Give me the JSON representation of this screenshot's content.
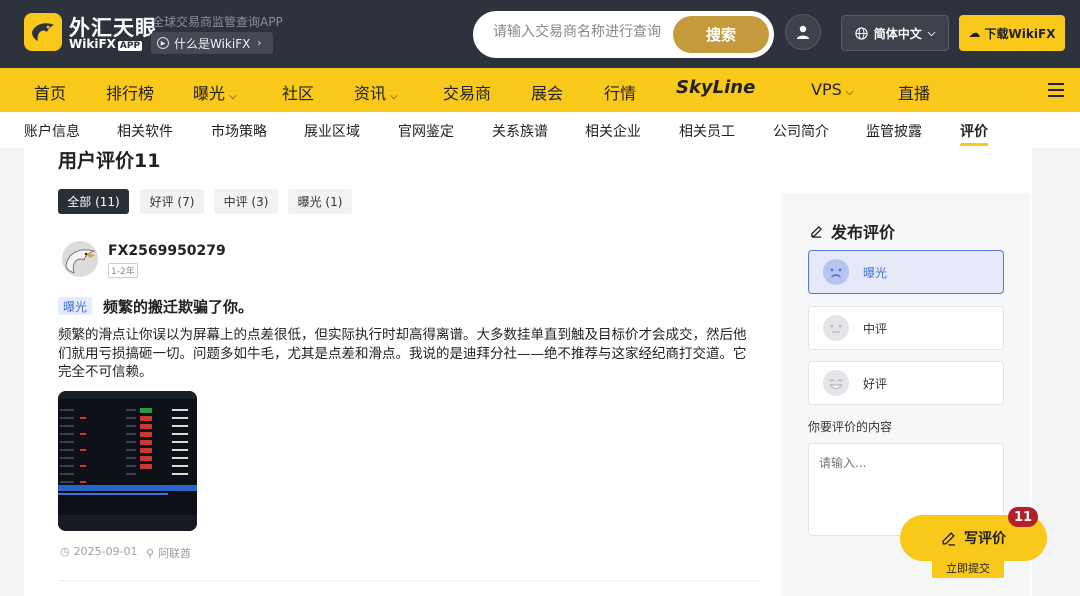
{
  "header": {
    "logo_cn": "外汇天眼",
    "logo_en": "WikiFX",
    "logo_app": "APP",
    "tagline": "全球交易商监管查询APP",
    "what_label": "什么是WikiFX",
    "search_placeholder": "请输入交易商名称进行查询",
    "search_button": "搜索",
    "language": "简体中文",
    "download_label": "下载WikiFX"
  },
  "nav": {
    "items": [
      "首页",
      "排行榜",
      "曝光",
      "社区",
      "资讯",
      "交易商",
      "展会",
      "行情",
      "SkyLine",
      "VPS",
      "直播"
    ]
  },
  "subnav": {
    "items": [
      "账户信息",
      "相关软件",
      "市场策略",
      "展业区域",
      "官网鉴定",
      "关系族谱",
      "相关企业",
      "相关员工",
      "公司简介",
      "监管披露",
      "评价"
    ]
  },
  "main": {
    "title": "用户评价11",
    "filters": [
      "全部 (11)",
      "好评 (7)",
      "中评 (3)",
      "曝光 (1)"
    ],
    "review": {
      "username": "FX2569950279",
      "badge": "1-2年",
      "tag": "曝光",
      "title": "频繁的搬迁欺骗了你。",
      "body": "频繁的滑点让你误以为屏幕上的点差很低，但实际执行时却高得离谱。大多数挂单直到触及目标价才会成交，然后他们就用亏损搞砸一切。问题多如牛毛，尤其是点差和滑点。我说的是迪拜分社——绝不推荐与这家经纪商打交道。它完全不可信赖。",
      "date": "2025-09-01",
      "location": "阿联酋"
    }
  },
  "sidebar": {
    "title": "发布评价",
    "options": [
      "曝光",
      "中评",
      "好评"
    ],
    "content_label": "你要评价的内容",
    "content_placeholder": "请输入...",
    "write_label": "写评价",
    "count": "11",
    "submit_label": "立即提交"
  }
}
